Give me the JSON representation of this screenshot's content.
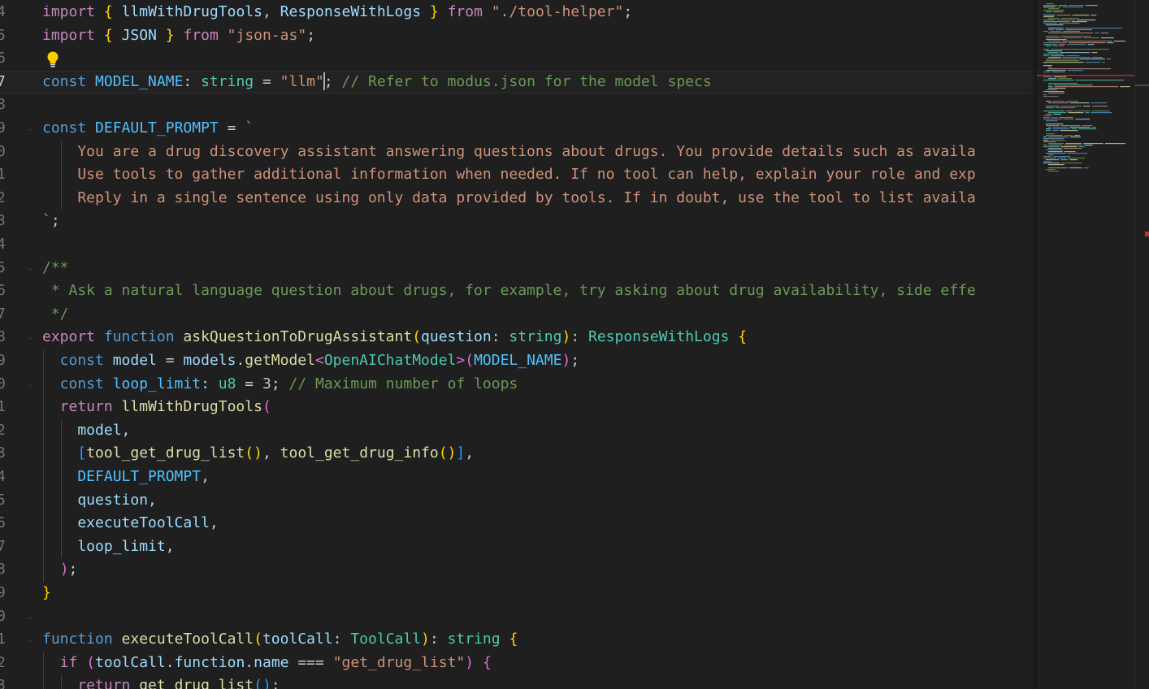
{
  "editor": {
    "language": "AssemblyScript",
    "current_line_number": "7",
    "colors": {
      "background": "#1f1f1f",
      "keyword": "#569cd6",
      "control_keyword": "#c586c0",
      "variable": "#9cdcfe",
      "constant": "#4fc1ff",
      "type": "#4ec9b0",
      "function": "#dcdcaa",
      "string": "#ce9178",
      "comment": "#6a9955",
      "number": "#b5cea8",
      "bracket_1": "#ffd700",
      "bracket_2": "#da70d6",
      "bracket_3": "#179fff",
      "line_number": "#6e7681"
    }
  },
  "lines": [
    {
      "num": "4",
      "tokens": [
        {
          "t": "import",
          "c": "kc"
        },
        {
          "t": " ",
          "c": "p"
        },
        {
          "t": "{",
          "c": "b1"
        },
        {
          "t": " ",
          "c": "p"
        },
        {
          "t": "llmWithDrugTools",
          "c": "v"
        },
        {
          "t": ", ",
          "c": "p"
        },
        {
          "t": "ResponseWithLogs",
          "c": "v"
        },
        {
          "t": " ",
          "c": "p"
        },
        {
          "t": "}",
          "c": "b1"
        },
        {
          "t": " ",
          "c": "p"
        },
        {
          "t": "from",
          "c": "kc"
        },
        {
          "t": " ",
          "c": "p"
        },
        {
          "t": "\"./tool-helper\"",
          "c": "s"
        },
        {
          "t": ";",
          "c": "p"
        }
      ]
    },
    {
      "num": "5",
      "tokens": [
        {
          "t": "import",
          "c": "kc"
        },
        {
          "t": " ",
          "c": "p"
        },
        {
          "t": "{",
          "c": "b1"
        },
        {
          "t": " ",
          "c": "p"
        },
        {
          "t": "JSON",
          "c": "v"
        },
        {
          "t": " ",
          "c": "p"
        },
        {
          "t": "}",
          "c": "b1"
        },
        {
          "t": " ",
          "c": "p"
        },
        {
          "t": "from",
          "c": "kc"
        },
        {
          "t": " ",
          "c": "p"
        },
        {
          "t": "\"json-as\"",
          "c": "s"
        },
        {
          "t": ";",
          "c": "p"
        }
      ]
    },
    {
      "num": "6",
      "bulb": true,
      "tokens": []
    },
    {
      "num": "7",
      "current": true,
      "tokens": [
        {
          "t": "const",
          "c": "k"
        },
        {
          "t": " ",
          "c": "p"
        },
        {
          "t": "MODEL_NAME",
          "c": "c"
        },
        {
          "t": ": ",
          "c": "p"
        },
        {
          "t": "string",
          "c": "t"
        },
        {
          "t": " = ",
          "c": "p"
        },
        {
          "t": "\"llm\"",
          "c": "s"
        },
        {
          "t": "|",
          "c": "cursor"
        },
        {
          "t": "; ",
          "c": "p"
        },
        {
          "t": "// Refer to modus.json for the model specs",
          "c": "cm"
        }
      ]
    },
    {
      "num": "8",
      "tokens": []
    },
    {
      "num": "9",
      "tokens": [
        {
          "t": "const",
          "c": "k"
        },
        {
          "t": " ",
          "c": "p"
        },
        {
          "t": "DEFAULT_PROMPT",
          "c": "c"
        },
        {
          "t": " = ",
          "c": "p"
        },
        {
          "t": "`",
          "c": "s"
        }
      ]
    },
    {
      "num": "0",
      "guides": [
        1
      ],
      "tokens": [
        {
          "t": "    You are a drug discovery assistant answering questions about drugs. You provide details such as availa",
          "c": "s"
        }
      ]
    },
    {
      "num": "1",
      "guides": [
        1
      ],
      "tokens": [
        {
          "t": "    Use tools to gather additional information when needed. If no tool can help, explain your role and exp",
          "c": "s"
        }
      ]
    },
    {
      "num": "2",
      "guides": [
        1
      ],
      "tokens": [
        {
          "t": "    Reply in a single sentence using only data provided by tools. If in doubt, use the tool to list availa",
          "c": "s"
        }
      ]
    },
    {
      "num": "3",
      "tokens": [
        {
          "t": "`",
          "c": "s"
        },
        {
          "t": ";",
          "c": "p"
        }
      ]
    },
    {
      "num": "4",
      "tokens": []
    },
    {
      "num": "5",
      "tokens": [
        {
          "t": "/**",
          "c": "cm"
        }
      ]
    },
    {
      "num": "6",
      "tokens": [
        {
          "t": " * Ask a natural language question about drugs, for example, try asking about drug availability, side effe",
          "c": "cm"
        }
      ]
    },
    {
      "num": "7",
      "tokens": [
        {
          "t": " */",
          "c": "cm"
        }
      ]
    },
    {
      "num": "8",
      "tokens": [
        {
          "t": "export",
          "c": "kc"
        },
        {
          "t": " ",
          "c": "p"
        },
        {
          "t": "function",
          "c": "k"
        },
        {
          "t": " ",
          "c": "p"
        },
        {
          "t": "askQuestionToDrugAssistant",
          "c": "f"
        },
        {
          "t": "(",
          "c": "b1"
        },
        {
          "t": "question",
          "c": "v"
        },
        {
          "t": ": ",
          "c": "p"
        },
        {
          "t": "string",
          "c": "t"
        },
        {
          "t": ")",
          "c": "b1"
        },
        {
          "t": ": ",
          "c": "p"
        },
        {
          "t": "ResponseWithLogs",
          "c": "t"
        },
        {
          "t": " ",
          "c": "p"
        },
        {
          "t": "{",
          "c": "b1"
        }
      ]
    },
    {
      "num": "9",
      "guides": [
        0
      ],
      "tokens": [
        {
          "t": "  const",
          "c": "k"
        },
        {
          "t": " ",
          "c": "p"
        },
        {
          "t": "model",
          "c": "v"
        },
        {
          "t": " = ",
          "c": "p"
        },
        {
          "t": "models",
          "c": "v"
        },
        {
          "t": ".",
          "c": "p"
        },
        {
          "t": "getModel",
          "c": "f"
        },
        {
          "t": "<",
          "c": "b2"
        },
        {
          "t": "OpenAIChatModel",
          "c": "t"
        },
        {
          "t": ">",
          "c": "b2"
        },
        {
          "t": "(",
          "c": "b2"
        },
        {
          "t": "MODEL_NAME",
          "c": "c"
        },
        {
          "t": ")",
          "c": "b2"
        },
        {
          "t": ";",
          "c": "p"
        }
      ]
    },
    {
      "num": "0",
      "guides": [
        0
      ],
      "tokens": [
        {
          "t": "  const",
          "c": "k"
        },
        {
          "t": " ",
          "c": "p"
        },
        {
          "t": "loop_limit",
          "c": "c"
        },
        {
          "t": ": ",
          "c": "p"
        },
        {
          "t": "u8",
          "c": "t"
        },
        {
          "t": " = ",
          "c": "p"
        },
        {
          "t": "3",
          "c": "n"
        },
        {
          "t": "; ",
          "c": "p"
        },
        {
          "t": "// Maximum number of loops",
          "c": "cm"
        }
      ]
    },
    {
      "num": "1",
      "guides": [
        0
      ],
      "tokens": [
        {
          "t": "  return",
          "c": "kc"
        },
        {
          "t": " ",
          "c": "p"
        },
        {
          "t": "llmWithDrugTools",
          "c": "f"
        },
        {
          "t": "(",
          "c": "b2"
        }
      ]
    },
    {
      "num": "2",
      "guides": [
        0,
        1
      ],
      "tokens": [
        {
          "t": "    model",
          "c": "v"
        },
        {
          "t": ",",
          "c": "p"
        }
      ]
    },
    {
      "num": "3",
      "guides": [
        0,
        1
      ],
      "tokens": [
        {
          "t": "    ",
          "c": "p"
        },
        {
          "t": "[",
          "c": "b3"
        },
        {
          "t": "tool_get_drug_list",
          "c": "f"
        },
        {
          "t": "()",
          "c": "b1"
        },
        {
          "t": ", ",
          "c": "p"
        },
        {
          "t": "tool_get_drug_info",
          "c": "f"
        },
        {
          "t": "()",
          "c": "b1"
        },
        {
          "t": "]",
          "c": "b3"
        },
        {
          "t": ",",
          "c": "p"
        }
      ]
    },
    {
      "num": "4",
      "guides": [
        0,
        1
      ],
      "tokens": [
        {
          "t": "    DEFAULT_PROMPT",
          "c": "c"
        },
        {
          "t": ",",
          "c": "p"
        }
      ]
    },
    {
      "num": "5",
      "guides": [
        0,
        1
      ],
      "tokens": [
        {
          "t": "    question",
          "c": "v"
        },
        {
          "t": ",",
          "c": "p"
        }
      ]
    },
    {
      "num": "6",
      "guides": [
        0,
        1
      ],
      "tokens": [
        {
          "t": "    executeToolCall",
          "c": "v"
        },
        {
          "t": ",",
          "c": "p"
        }
      ]
    },
    {
      "num": "7",
      "guides": [
        0,
        1
      ],
      "tokens": [
        {
          "t": "    loop_limit",
          "c": "v"
        },
        {
          "t": ",",
          "c": "p"
        }
      ]
    },
    {
      "num": "8",
      "guides": [
        0
      ],
      "tokens": [
        {
          "t": "  ",
          "c": "p"
        },
        {
          "t": ")",
          "c": "b2"
        },
        {
          "t": ";",
          "c": "p"
        }
      ]
    },
    {
      "num": "9",
      "tokens": [
        {
          "t": "}",
          "c": "b1"
        }
      ]
    },
    {
      "num": "0",
      "tokens": []
    },
    {
      "num": "1",
      "tokens": [
        {
          "t": "function",
          "c": "k"
        },
        {
          "t": " ",
          "c": "p"
        },
        {
          "t": "executeToolCall",
          "c": "f"
        },
        {
          "t": "(",
          "c": "b1"
        },
        {
          "t": "toolCall",
          "c": "v"
        },
        {
          "t": ": ",
          "c": "p"
        },
        {
          "t": "ToolCall",
          "c": "t"
        },
        {
          "t": ")",
          "c": "b1"
        },
        {
          "t": ": ",
          "c": "p"
        },
        {
          "t": "string",
          "c": "t"
        },
        {
          "t": " ",
          "c": "p"
        },
        {
          "t": "{",
          "c": "b1"
        }
      ]
    },
    {
      "num": "2",
      "guides": [
        0
      ],
      "tokens": [
        {
          "t": "  if",
          "c": "kc"
        },
        {
          "t": " ",
          "c": "p"
        },
        {
          "t": "(",
          "c": "b2"
        },
        {
          "t": "toolCall",
          "c": "v"
        },
        {
          "t": ".",
          "c": "p"
        },
        {
          "t": "function",
          "c": "v"
        },
        {
          "t": ".",
          "c": "p"
        },
        {
          "t": "name",
          "c": "v"
        },
        {
          "t": " === ",
          "c": "p"
        },
        {
          "t": "\"get_drug_list\"",
          "c": "s"
        },
        {
          "t": ")",
          "c": "b2"
        },
        {
          "t": " ",
          "c": "p"
        },
        {
          "t": "{",
          "c": "b2"
        }
      ]
    },
    {
      "num": "3",
      "guides": [
        0,
        1
      ],
      "tokens": [
        {
          "t": "    return",
          "c": "kc"
        },
        {
          "t": " ",
          "c": "p"
        },
        {
          "t": "get_drug_list",
          "c": "f"
        },
        {
          "t": "()",
          "c": "b3"
        },
        {
          "t": ";",
          "c": "p"
        }
      ]
    }
  ],
  "fold_lines": [
    5,
    11,
    14,
    16,
    26,
    27
  ]
}
